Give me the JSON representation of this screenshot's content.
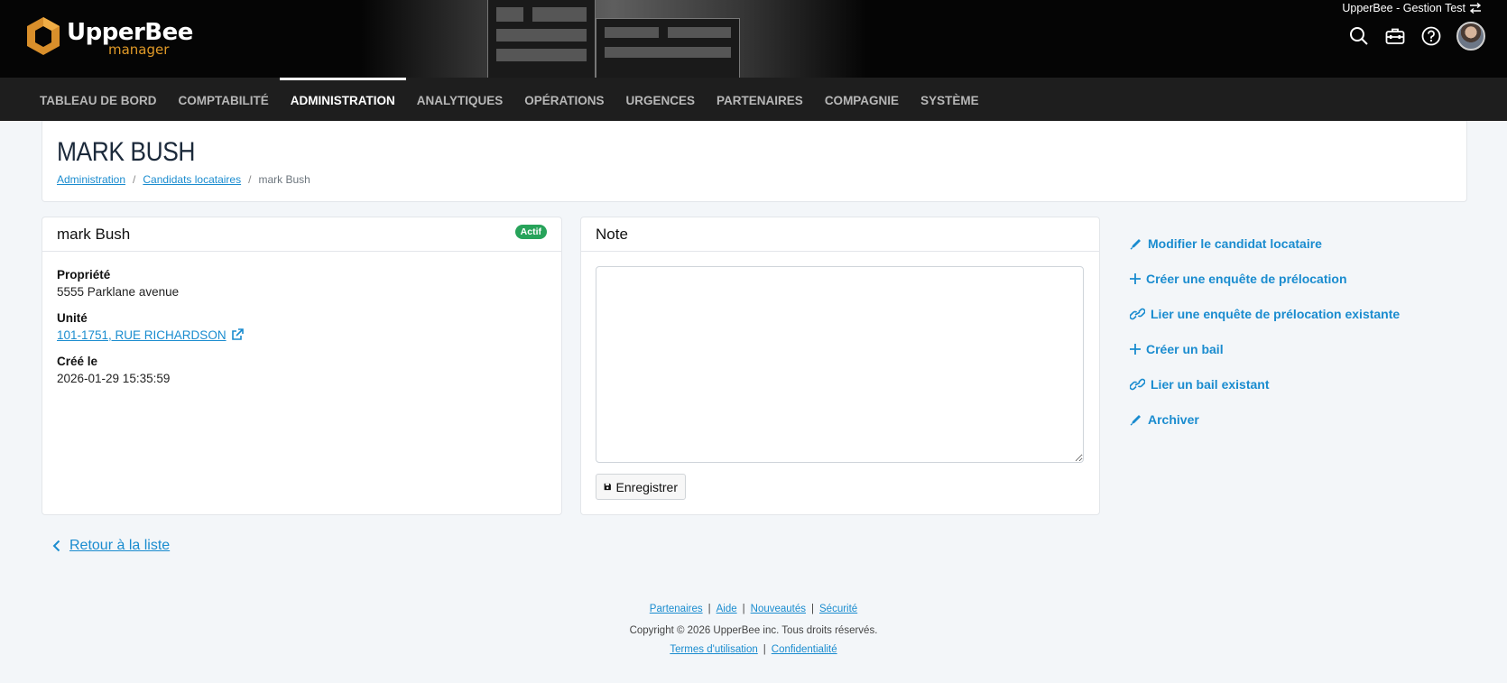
{
  "brand": {
    "title": "UpperBee",
    "subtitle": "manager"
  },
  "account": {
    "name": "UpperBee - Gestion Test"
  },
  "header_icons": [
    "search-icon",
    "toolbox-icon",
    "help-icon",
    "avatar"
  ],
  "nav": [
    {
      "label": "TABLEAU DE BORD",
      "active": false
    },
    {
      "label": "COMPTABILITÉ",
      "active": false
    },
    {
      "label": "ADMINISTRATION",
      "active": true
    },
    {
      "label": "ANALYTIQUES",
      "active": false
    },
    {
      "label": "OPÉRATIONS",
      "active": false
    },
    {
      "label": "URGENCES",
      "active": false
    },
    {
      "label": "PARTENAIRES",
      "active": false
    },
    {
      "label": "COMPAGNIE",
      "active": false
    },
    {
      "label": "SYSTÈME",
      "active": false
    }
  ],
  "page": {
    "title": "MARK BUSH",
    "breadcrumb": [
      "Administration",
      "Candidats locataires",
      "mark Bush"
    ]
  },
  "candidate": {
    "name": "mark Bush",
    "status": "Actif",
    "property_label": "Propriété",
    "property_value": "5555 Parklane avenue",
    "unit_label": "Unité",
    "unit_value": "101-1751, RUE RICHARDSON",
    "created_label": "Créé le",
    "created_value": "2026-01-29 15:35:59"
  },
  "note": {
    "title": "Note",
    "value": "",
    "save_label": "Enregistrer"
  },
  "actions": [
    {
      "label": "Modifier le candidat locataire",
      "icon": "pencil-icon"
    },
    {
      "label": "Créer une enquête de prélocation",
      "icon": "plus-icon"
    },
    {
      "label": "Lier une enquête de prélocation existante",
      "icon": "link-icon"
    },
    {
      "label": "Créer un bail",
      "icon": "plus-icon"
    },
    {
      "label": "Lier un bail existant",
      "icon": "link-icon"
    },
    {
      "label": "Archiver",
      "icon": "pencil-icon"
    }
  ],
  "back_label": "Retour à la liste",
  "footer": {
    "links": [
      "Partenaires",
      "Aide",
      "Nouveautés",
      "Sécurité"
    ],
    "copyright": "Copyright © 2026 UpperBee inc. Tous droits réservés.",
    "legal": [
      "Termes d'utilisation",
      "Confidentialité"
    ]
  }
}
